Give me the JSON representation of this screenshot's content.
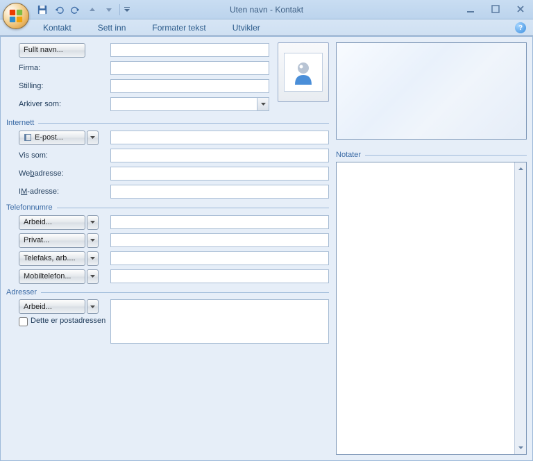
{
  "window": {
    "title_left": "Uten navn",
    "title_sep": " - ",
    "title_right": "Kontakt"
  },
  "tabs": {
    "kontakt": "Kontakt",
    "sett_inn": "Sett inn",
    "formater": "Formater tekst",
    "utvikler": "Utvikler"
  },
  "labels": {
    "fullt_navn_btn": "Fullt navn...",
    "firma": "Firma:",
    "stilling": "Stilling:",
    "arkiver_som": "Arkiver som:",
    "internett": "Internett",
    "epost_btn": "E-post...",
    "vis_som": "Vis som:",
    "webadresse": "Webadresse:",
    "webadresse_key": "b",
    "im_adresse": "IM-adresse:",
    "im_key": "M",
    "telefonnumre": "Telefonnumre",
    "arbeid_btn": "Arbeid...",
    "privat_btn": "Privat...",
    "telefaks_btn": "Telefaks, arb....",
    "mobil_btn": "Mobiltelefon...",
    "adresser": "Adresser",
    "arbeid_addr_btn": "Arbeid...",
    "postadresse_chk": "Dette er postadressen",
    "notater": "Notater"
  },
  "values": {
    "fullt_navn": "",
    "firma": "",
    "stilling": "",
    "arkiver_som": "",
    "epost": "",
    "vis_som": "",
    "webadresse": "",
    "im": "",
    "tel_arbeid": "",
    "tel_privat": "",
    "tel_faks": "",
    "tel_mobil": "",
    "addr_arbeid": "",
    "postadresse_checked": false,
    "notater": ""
  },
  "colors": {
    "accent": "#3a6aa5",
    "border": "#9db9d9"
  }
}
